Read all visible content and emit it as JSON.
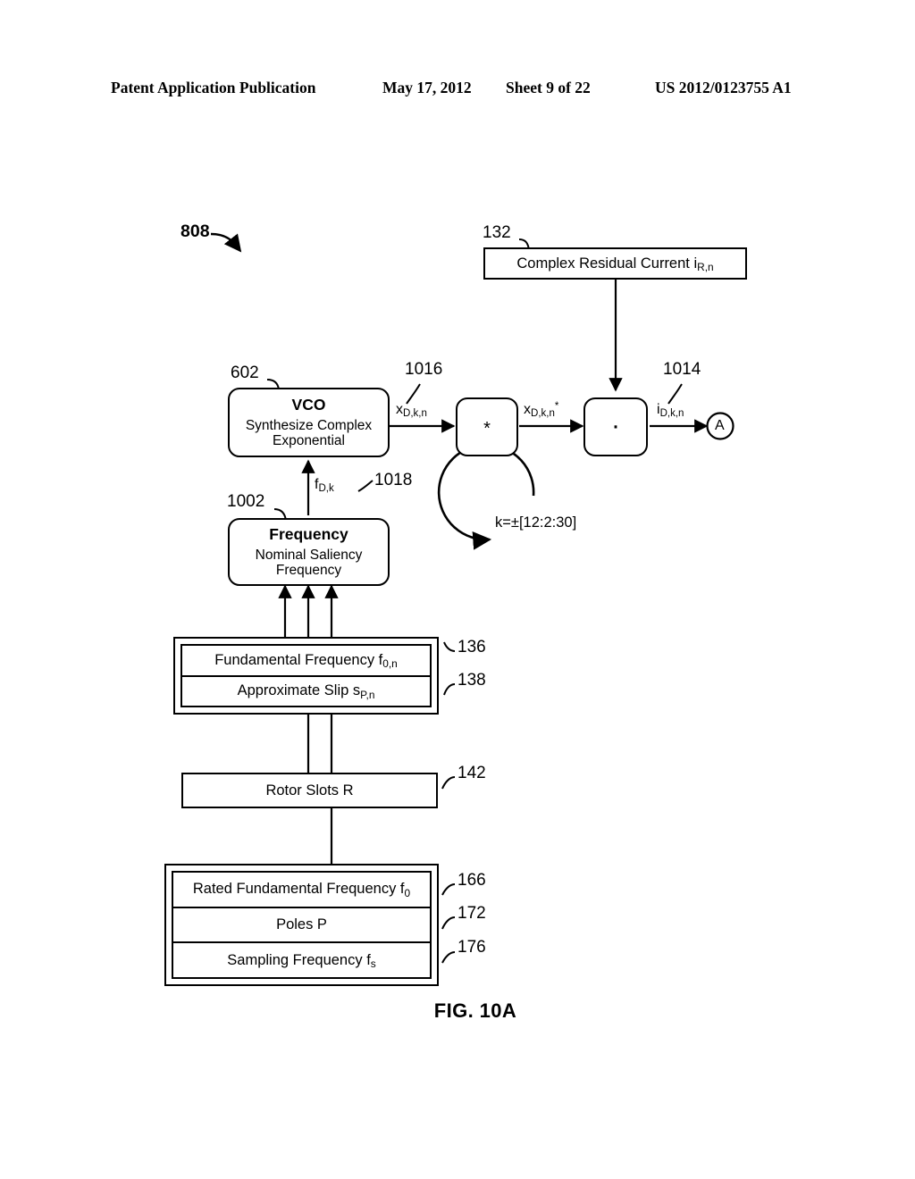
{
  "header": {
    "publication": "Patent Application Publication",
    "date": "May 17, 2012",
    "sheet": "Sheet 9 of 22",
    "number": "US 2012/0123755 A1"
  },
  "figure": {
    "caption": "FIG. 10A",
    "diagram_tag": "808",
    "refs": {
      "residual_current": "132",
      "vco": "602",
      "vco_output": "1016",
      "conj_output_ref": "1014",
      "frequency": "1002",
      "frequency_output": "1018",
      "fundamental_frequency": "136",
      "approximate_slip": "138",
      "rotor_slots": "142",
      "rated_fundamental_frequency": "166",
      "poles": "172",
      "sampling_frequency": "176"
    },
    "blocks": {
      "residual_current": {
        "label": "Complex Residual Current i",
        "sub": "R,n"
      },
      "vco": {
        "title": "VCO",
        "line1": "Synthesize Complex",
        "line2": "Exponential"
      },
      "conjugate_op": {
        "glyph": "*"
      },
      "multiply_op": {
        "glyph": "·"
      },
      "frequency": {
        "title": "Frequency",
        "line1": "Nominal Saliency",
        "line2": "Frequency"
      },
      "fundamental_frequency": {
        "label": "Fundamental Frequency f",
        "sub": "0,n"
      },
      "approximate_slip": {
        "label": "Approximate Slip s",
        "sub": "P,n"
      },
      "rotor_slots": {
        "label": "Rotor Slots R"
      },
      "rated_fundamental_frequency": {
        "label": "Rated Fundamental Frequency f",
        "sub": "0"
      },
      "poles": {
        "label": "Poles P"
      },
      "sampling_frequency": {
        "label": "Sampling Frequency f",
        "sub": "s"
      },
      "connector_a": {
        "label": "A"
      }
    },
    "signals": {
      "vco_out": {
        "base": "x",
        "sub": "D,k,n"
      },
      "conj_out": {
        "base": "x",
        "sub": "D,k,n",
        "sup": "*"
      },
      "mult_out": {
        "base": "i",
        "sub": "D,k,n"
      },
      "freq_out": {
        "base": "f",
        "sub": "D,k"
      }
    },
    "loop_annotation": "k=±[12:2:30]"
  }
}
